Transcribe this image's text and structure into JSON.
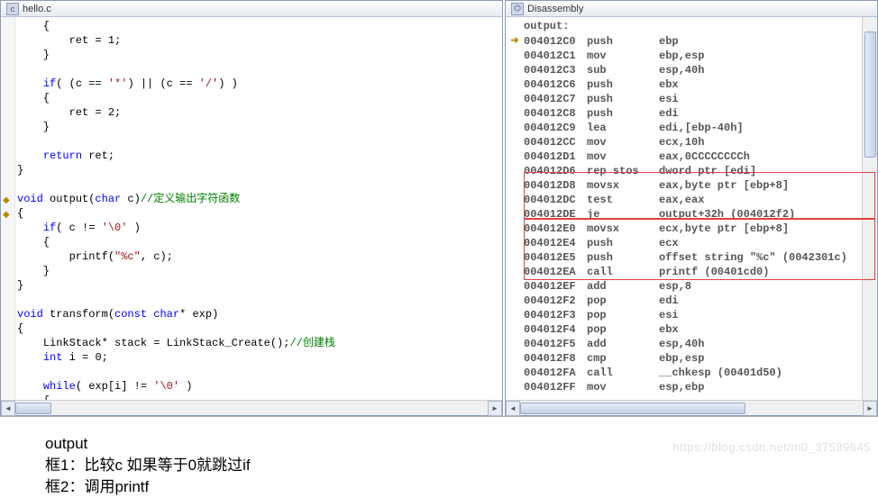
{
  "left_tab": {
    "title": "hello.c",
    "icon": "c-file-icon"
  },
  "right_tab": {
    "title": "Disassembly",
    "icon": "disasm-icon"
  },
  "code": {
    "lines": [
      {
        "indent": 1,
        "text": "{"
      },
      {
        "indent": 2,
        "segs": [
          {
            "t": "ret = "
          },
          {
            "t": "1",
            "cls": "num"
          },
          {
            "t": ";"
          }
        ]
      },
      {
        "indent": 1,
        "text": "}"
      },
      {
        "blank": true
      },
      {
        "indent": 1,
        "segs": [
          {
            "t": "if",
            "cls": "kw"
          },
          {
            "t": "( (c == "
          },
          {
            "t": "'*'",
            "cls": "str"
          },
          {
            "t": ") || (c == "
          },
          {
            "t": "'/'",
            "cls": "str"
          },
          {
            "t": ") )"
          }
        ]
      },
      {
        "indent": 1,
        "text": "{"
      },
      {
        "indent": 2,
        "segs": [
          {
            "t": "ret = "
          },
          {
            "t": "2",
            "cls": "num"
          },
          {
            "t": ";"
          }
        ]
      },
      {
        "indent": 1,
        "text": "}"
      },
      {
        "blank": true
      },
      {
        "indent": 1,
        "segs": [
          {
            "t": "return",
            "cls": "kw"
          },
          {
            "t": " ret;"
          }
        ]
      },
      {
        "indent": 0,
        "text": "}"
      },
      {
        "blank": true
      },
      {
        "indent": 0,
        "segs": [
          {
            "t": "void",
            "cls": "kw"
          },
          {
            "t": " output("
          },
          {
            "t": "char",
            "cls": "kw"
          },
          {
            "t": " c)"
          },
          {
            "t": "//定义输出字符函数",
            "cls": "cmt"
          }
        ],
        "brk": true
      },
      {
        "indent": 0,
        "text": "{",
        "brk": true
      },
      {
        "indent": 1,
        "segs": [
          {
            "t": "if",
            "cls": "kw"
          },
          {
            "t": "( c != "
          },
          {
            "t": "'\\0'",
            "cls": "str"
          },
          {
            "t": " )"
          }
        ]
      },
      {
        "indent": 1,
        "text": "{"
      },
      {
        "indent": 2,
        "segs": [
          {
            "t": "printf("
          },
          {
            "t": "\"%c\"",
            "cls": "str"
          },
          {
            "t": ", c);"
          }
        ]
      },
      {
        "indent": 1,
        "text": "}"
      },
      {
        "indent": 0,
        "text": "}"
      },
      {
        "blank": true
      },
      {
        "indent": 0,
        "segs": [
          {
            "t": "void",
            "cls": "kw"
          },
          {
            "t": " transform("
          },
          {
            "t": "const",
            "cls": "kw"
          },
          {
            "t": " "
          },
          {
            "t": "char",
            "cls": "kw"
          },
          {
            "t": "* exp)"
          }
        ]
      },
      {
        "indent": 0,
        "text": "{"
      },
      {
        "indent": 1,
        "segs": [
          {
            "t": "LinkStack* stack = LinkStack_Create();"
          },
          {
            "t": "//创建栈",
            "cls": "cmt"
          }
        ]
      },
      {
        "indent": 1,
        "segs": [
          {
            "t": "int",
            "cls": "kw"
          },
          {
            "t": " i = "
          },
          {
            "t": "0",
            "cls": "num"
          },
          {
            "t": ";"
          }
        ]
      },
      {
        "blank": true
      },
      {
        "indent": 1,
        "segs": [
          {
            "t": "while",
            "cls": "kw"
          },
          {
            "t": "( exp[i] != "
          },
          {
            "t": "'\\0'",
            "cls": "str"
          },
          {
            "t": " )"
          }
        ]
      },
      {
        "indent": 1,
        "text": "{"
      }
    ]
  },
  "disasm": {
    "header": "output:",
    "rows": [
      {
        "arrow": true,
        "addr": "004012C0",
        "mne": "push",
        "ops": "ebp"
      },
      {
        "addr": "004012C1",
        "mne": "mov",
        "ops": "ebp,esp"
      },
      {
        "addr": "004012C3",
        "mne": "sub",
        "ops": "esp,40h"
      },
      {
        "addr": "004012C6",
        "mne": "push",
        "ops": "ebx"
      },
      {
        "addr": "004012C7",
        "mne": "push",
        "ops": "esi"
      },
      {
        "addr": "004012C8",
        "mne": "push",
        "ops": "edi"
      },
      {
        "addr": "004012C9",
        "mne": "lea",
        "ops": "edi,[ebp-40h]"
      },
      {
        "addr": "004012CC",
        "mne": "mov",
        "ops": "ecx,10h"
      },
      {
        "addr": "004012D1",
        "mne": "mov",
        "ops": "eax,0CCCCCCCCh"
      },
      {
        "addr": "004012D6",
        "mne": "rep stos",
        "ops": "dword ptr [edi]"
      },
      {
        "addr": "004012D8",
        "mne": "movsx",
        "ops": "eax,byte ptr [ebp+8]"
      },
      {
        "addr": "004012DC",
        "mne": "test",
        "ops": "eax,eax"
      },
      {
        "addr": "004012DE",
        "mne": "je",
        "ops": "output+32h (004012f2)"
      },
      {
        "addr": "004012E0",
        "mne": "movsx",
        "ops": "ecx,byte ptr [ebp+8]"
      },
      {
        "addr": "004012E4",
        "mne": "push",
        "ops": "ecx"
      },
      {
        "addr": "004012E5",
        "mne": "push",
        "ops": "offset string \"%c\" (0042301c)"
      },
      {
        "addr": "004012EA",
        "mne": "call",
        "ops": "printf (00401cd0)"
      },
      {
        "addr": "004012EF",
        "mne": "add",
        "ops": "esp,8"
      },
      {
        "addr": "004012F2",
        "mne": "pop",
        "ops": "edi"
      },
      {
        "addr": "004012F3",
        "mne": "pop",
        "ops": "esi"
      },
      {
        "addr": "004012F4",
        "mne": "pop",
        "ops": "ebx"
      },
      {
        "addr": "004012F5",
        "mne": "add",
        "ops": "esp,40h"
      },
      {
        "addr": "004012F8",
        "mne": "cmp",
        "ops": "ebp,esp"
      },
      {
        "addr": "004012FA",
        "mne": "call",
        "ops": "__chkesp (00401d50)"
      },
      {
        "addr": "004012FF",
        "mne": "mov",
        "ops": "esp,ebp"
      }
    ]
  },
  "notes": {
    "l1": "output",
    "l2": "框1：比较c 如果等于0就跳过if",
    "l3": "框2：调用printf"
  },
  "watermark": "https://blog.csdn.net/m0_37599645"
}
